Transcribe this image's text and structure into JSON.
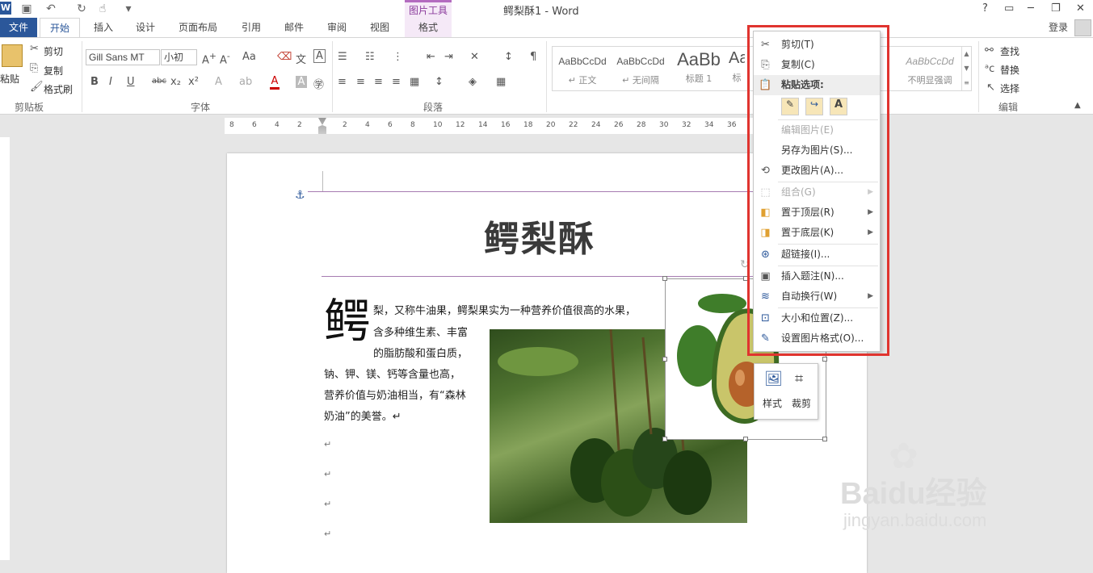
{
  "window": {
    "title": "鳄梨酥1 - Word",
    "context_tab_group": "图片工具",
    "help": "?",
    "restore": "▭",
    "minimize": "─",
    "maximize": "❐",
    "close": "✕"
  },
  "quick_access": {
    "undo": "↶",
    "redo": "↻",
    "touch": "☝",
    "customize": "▾"
  },
  "tabs": [
    "文件",
    "开始",
    "插入",
    "设计",
    "页面布局",
    "引用",
    "邮件",
    "审阅",
    "视图",
    "格式"
  ],
  "account": {
    "login": "登录"
  },
  "ribbon": {
    "clipboard": {
      "paste": "粘贴",
      "cut": "剪切",
      "copy": "复制",
      "format_painter": "格式刷",
      "label": "剪贴板"
    },
    "font": {
      "name": "Gill Sans MT",
      "size": "小初",
      "label": "字体"
    },
    "paragraph": {
      "label": "段落"
    },
    "styles": {
      "items": [
        {
          "sample": "AaBbCcDd",
          "name": "↵ 正文"
        },
        {
          "sample": "AaBbCcDd",
          "name": "↵ 无间隔"
        },
        {
          "sample": "AaBb",
          "name": "标题 1"
        },
        {
          "sample": "AaI",
          "name": "标"
        },
        {
          "sample": "AaBbCcDd",
          "name": "不明显强调"
        }
      ]
    },
    "editing": {
      "find": "查找",
      "replace": "替换",
      "select": "选择",
      "label": "编辑"
    }
  },
  "ruler": {
    "numbers": [
      "8",
      "6",
      "4",
      "2",
      "2",
      "4",
      "6",
      "8",
      "10",
      "12",
      "14",
      "16",
      "18",
      "20",
      "22",
      "24",
      "26",
      "28",
      "30",
      "32",
      "34",
      "36"
    ]
  },
  "document": {
    "title": "鳄梨酥",
    "dropcap": "鳄",
    "lines": [
      "梨，又称牛油果，鳄梨果实为一种营养价值很高的水果，",
      "含多种维生素、丰富",
      "的脂肪酸和蛋白质，",
      "钠、钾、镁、钙等含量也高，",
      "营养价值与奶油相当，有“森林",
      "奶油”的美誉。↵"
    ],
    "para_marks": [
      "↵",
      "↵",
      "↵",
      "↵"
    ]
  },
  "context_menu": {
    "items": [
      {
        "label": "剪切(T)",
        "icon": "scissors-icon",
        "glyph": "✂",
        "disabled": false
      },
      {
        "label": "复制(C)",
        "icon": "copy-icon",
        "glyph": "⎘",
        "disabled": false
      },
      {
        "label": "粘贴选项:",
        "icon": "paste-icon",
        "glyph": "📋",
        "disabled": false
      },
      {
        "label": "编辑图片(E)",
        "icon": "",
        "glyph": "",
        "disabled": true
      },
      {
        "label": "另存为图片(S)...",
        "icon": "",
        "glyph": "",
        "disabled": false
      },
      {
        "label": "更改图片(A)...",
        "icon": "change-picture-icon",
        "glyph": "⟲",
        "disabled": false
      },
      {
        "label": "组合(G)",
        "icon": "group-icon",
        "glyph": "⬚",
        "disabled": true
      },
      {
        "label": "置于顶层(R)",
        "icon": "bring-front-icon",
        "glyph": "◧",
        "disabled": false
      },
      {
        "label": "置于底层(K)",
        "icon": "send-back-icon",
        "glyph": "◨",
        "disabled": false
      },
      {
        "label": "超链接(I)...",
        "icon": "hyperlink-icon",
        "glyph": "⊛",
        "disabled": false
      },
      {
        "label": "插入题注(N)...",
        "icon": "caption-icon",
        "glyph": "▣",
        "disabled": false
      },
      {
        "label": "自动换行(W)",
        "icon": "wrap-text-icon",
        "glyph": "≋",
        "disabled": false
      },
      {
        "label": "大小和位置(Z)...",
        "icon": "size-position-icon",
        "glyph": "⊡",
        "disabled": false
      },
      {
        "label": "设置图片格式(O)...",
        "icon": "format-picture-icon",
        "glyph": "✎",
        "disabled": false
      }
    ],
    "submenu_arrow": "▶"
  },
  "mini_toolbar": {
    "style": "样式",
    "crop": "裁剪"
  },
  "watermark": {
    "brand": "Baidu经验",
    "url": "jingyan.baidu.com"
  },
  "colors": {
    "accent": "#2b579a",
    "context": "#8b3c9c",
    "highlight": "#e0342f"
  }
}
